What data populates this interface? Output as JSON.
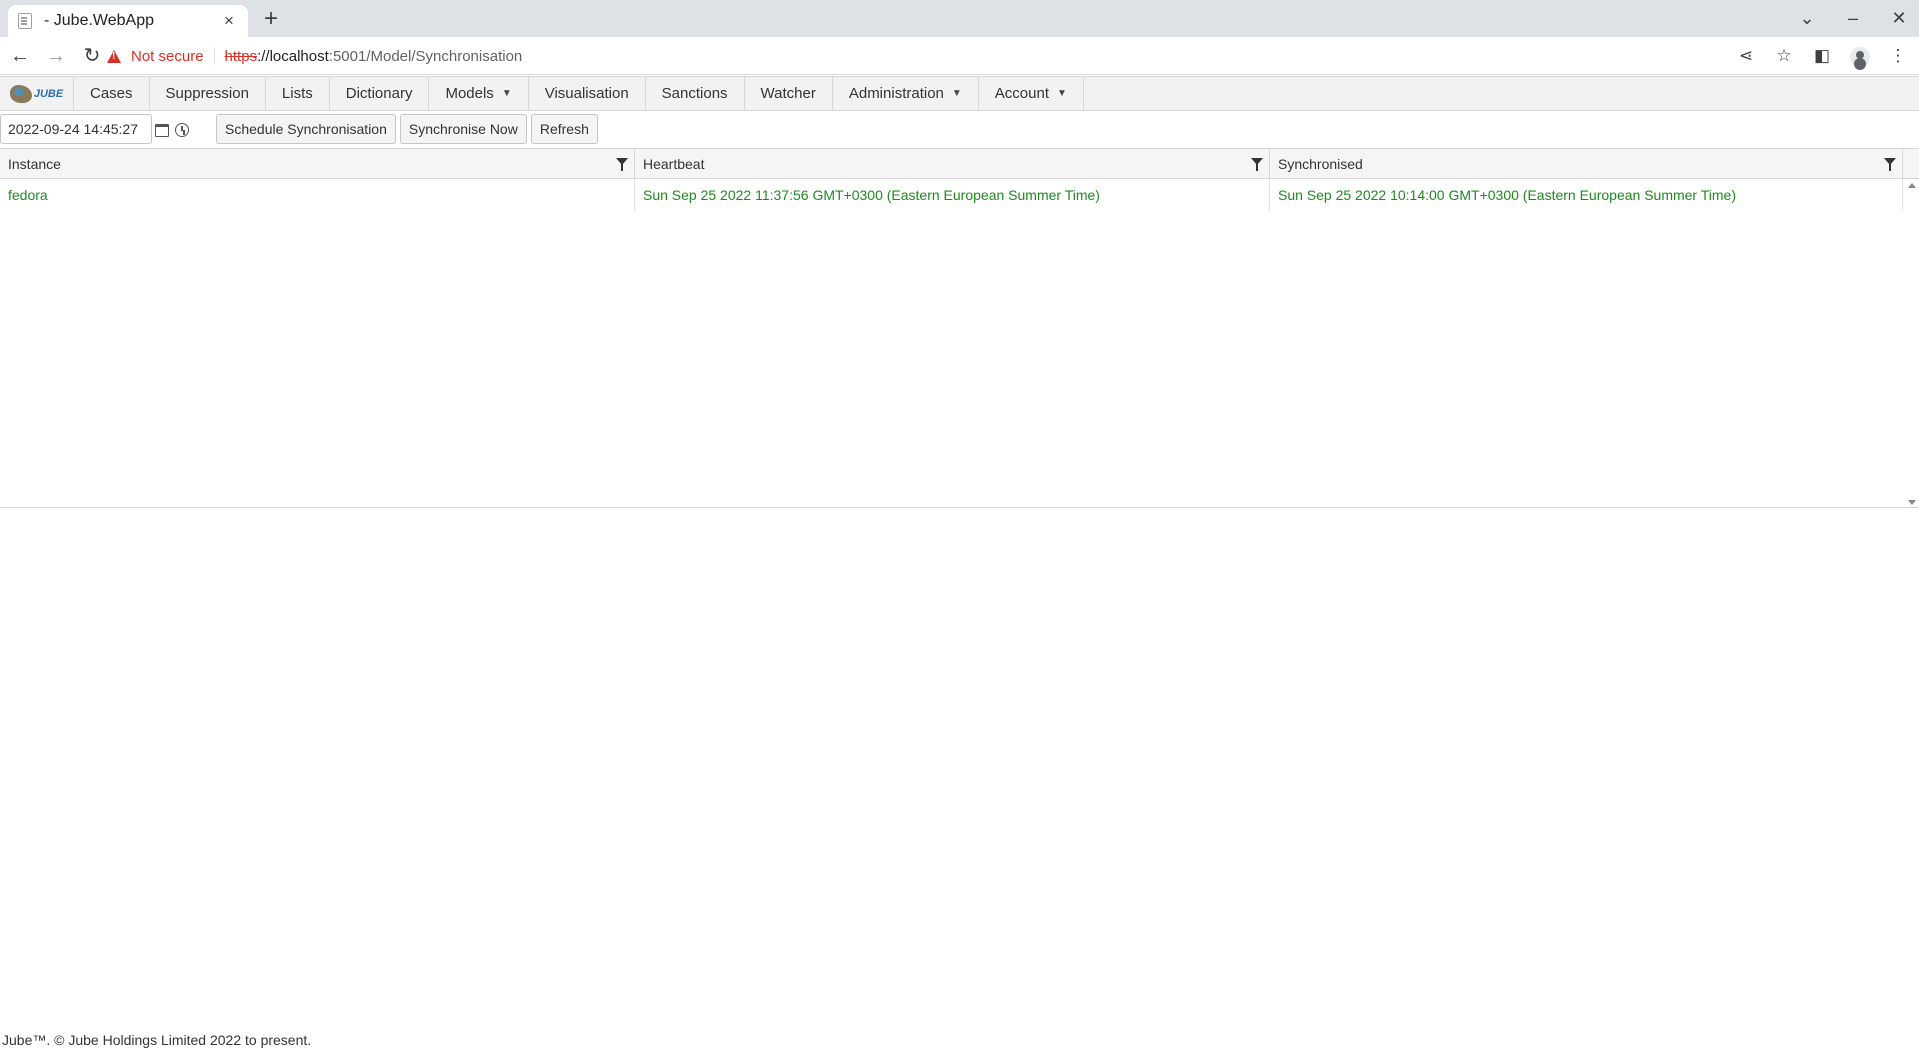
{
  "browser": {
    "tab_title": "- Jube.WebApp",
    "tab_close": "×",
    "new_tab": "+",
    "not_secure": "Not secure",
    "url_scheme": "https",
    "url_host": "://localhost",
    "url_path": ":5001/Model/Synchronisation"
  },
  "menu": {
    "logo_text": "JUBE",
    "items": [
      {
        "label": "Cases"
      },
      {
        "label": "Suppression"
      },
      {
        "label": "Lists"
      },
      {
        "label": "Dictionary"
      },
      {
        "label": "Models",
        "dropdown": true
      },
      {
        "label": "Visualisation"
      },
      {
        "label": "Sanctions"
      },
      {
        "label": "Watcher"
      },
      {
        "label": "Administration",
        "dropdown": true
      },
      {
        "label": "Account",
        "dropdown": true
      }
    ]
  },
  "actions": {
    "date_value": "2022-09-24 14:45:27",
    "schedule_label": "Schedule Synchronisation",
    "sync_now_label": "Synchronise Now",
    "refresh_label": "Refresh"
  },
  "grid": {
    "columns": [
      "Instance",
      "Heartbeat",
      "Synchronised"
    ],
    "rows": [
      {
        "instance": "fedora",
        "heartbeat": "Sun Sep 25 2022 11:37:56 GMT+0300 (Eastern European Summer Time)",
        "synchronised": "Sun Sep 25 2022 10:14:00 GMT+0300 (Eastern European Summer Time)"
      }
    ],
    "row_text_color": "#1e8a1e"
  },
  "footer": {
    "text": "Jube™. © Jube Holdings Limited 2022 to present."
  }
}
